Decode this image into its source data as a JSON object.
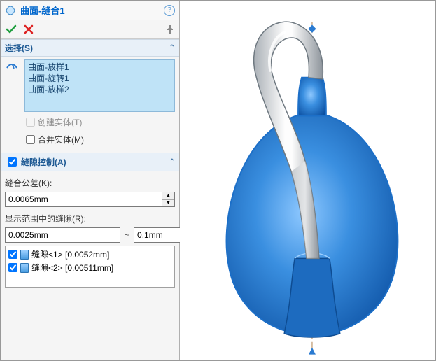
{
  "header": {
    "title": "曲面-缝合1"
  },
  "sections": {
    "selection": {
      "title": "选择(S)",
      "items": [
        "曲面-放样1",
        "曲面-旋转1",
        "曲面-放样2"
      ],
      "createSolidLabel": "创建实体(T)",
      "mergeEntitiesLabel": "合并实体(M)"
    },
    "gapControl": {
      "title": "缝隙控制(A)",
      "toleranceLabel": "缝合公差(K):",
      "toleranceValue": "0.0065mm",
      "rangeLabel": "显示范围中的缝隙(R):",
      "rangeMin": "0.0025mm",
      "rangeMax": "0.1mm",
      "gaps": [
        {
          "label": "缝隙<1> [0.0052mm]"
        },
        {
          "label": "缝隙<2> [0.00511mm]"
        }
      ]
    }
  }
}
